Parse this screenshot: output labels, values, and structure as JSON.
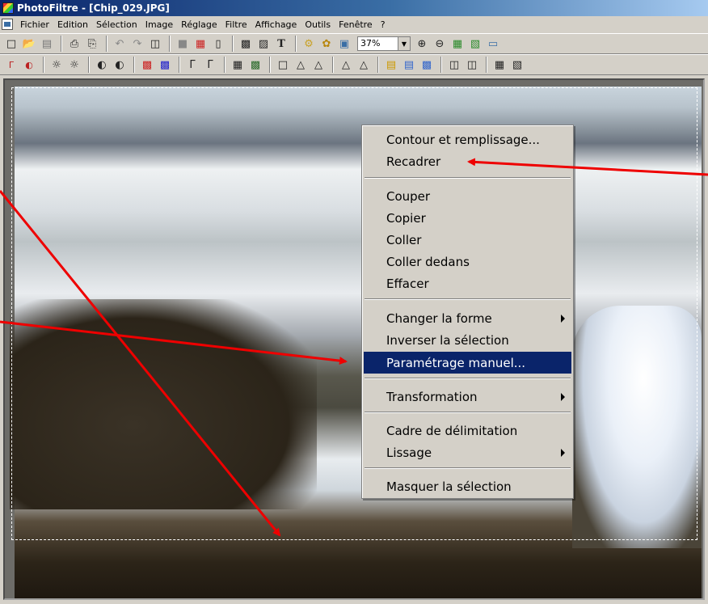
{
  "window": {
    "title": "PhotoFiltre - [Chip_029.JPG]"
  },
  "menubar": {
    "items": [
      "Fichier",
      "Edition",
      "Sélection",
      "Image",
      "Réglage",
      "Filtre",
      "Affichage",
      "Outils",
      "Fenêtre",
      "?"
    ]
  },
  "toolbar": {
    "zoom_value": "37%"
  },
  "context_menu": {
    "items": [
      "Contour et remplissage...",
      "Recadrer",
      "Couper",
      "Copier",
      "Coller",
      "Coller dedans",
      "Effacer",
      "Changer la forme",
      "Inverser la sélection",
      "Paramétrage manuel...",
      "Transformation",
      "Cadre de délimitation",
      "Lissage",
      "Masquer la sélection"
    ],
    "selected": "Paramétrage manuel..."
  },
  "colors": {
    "selection_highlight": "#0a246a",
    "annotation_arrow": "#ee0000"
  }
}
